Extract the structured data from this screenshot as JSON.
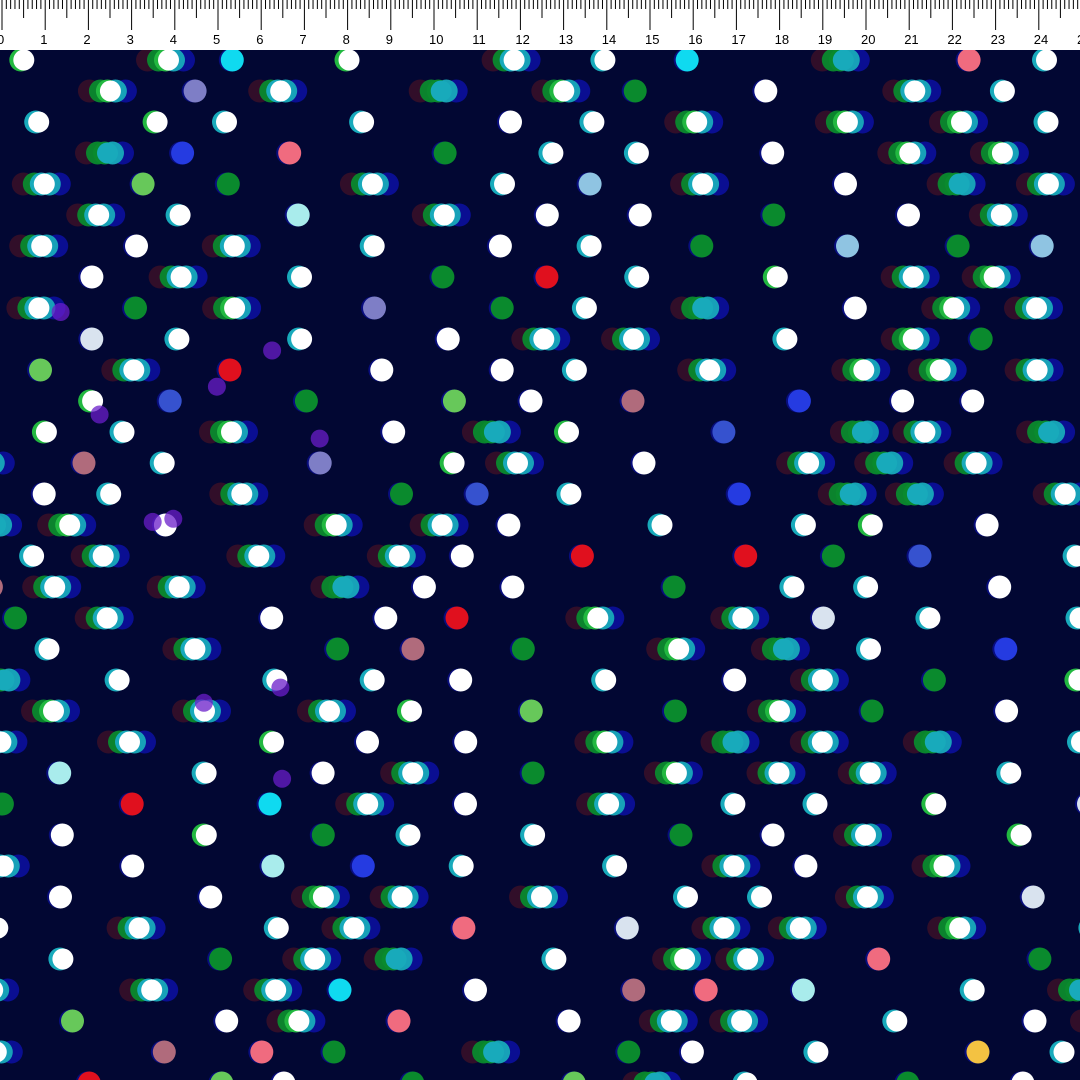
{
  "ruler": {
    "labels": [
      "0",
      "1",
      "2",
      "3",
      "4",
      "5",
      "6",
      "7",
      "8",
      "9",
      "10",
      "11",
      "12",
      "13",
      "14",
      "15",
      "16",
      "17",
      "18",
      "19",
      "20",
      "21",
      "22",
      "23",
      "24",
      "2"
    ]
  },
  "pattern": {
    "background": "#020733",
    "palette": {
      "white": "#ffffff",
      "cyan": "#0fdaf0",
      "teal": "#18aabb",
      "pale_cyan": "#a9ecec",
      "green": "#0a8a2d",
      "bright_green": "#22b840",
      "light_green": "#67c85a",
      "blue": "#253be1",
      "royal_blue": "#3652cf",
      "navy_halo": "#0b0f9c",
      "maroon_halo": "#3a0f28",
      "yellow": "#f3c242",
      "red": "#e0101e",
      "coral": "#f06b7f",
      "mauve": "#b06b7c",
      "lavender": "#7e7ec6",
      "powder": "#8fc4e2",
      "silver": "#d9e3ef",
      "violet": "#6a1ec9"
    }
  }
}
